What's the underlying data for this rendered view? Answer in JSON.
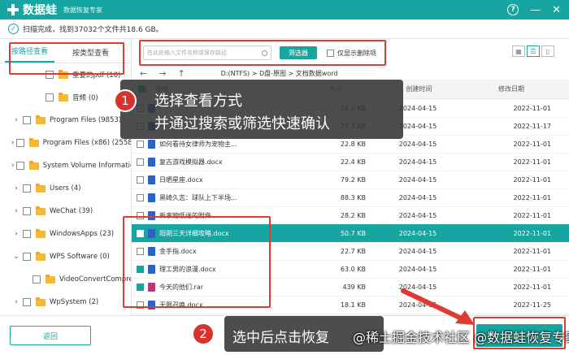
{
  "app": {
    "name": "数据蛙",
    "subtitle": "数据恢复专家",
    "help": "?",
    "minimize": "—",
    "close": "✕"
  },
  "status": {
    "text": "扫描完成，找到37032个文件共18.6 GB。"
  },
  "sidebar": {
    "tabs": [
      {
        "label": "按路径查看"
      },
      {
        "label": "按类型查看"
      }
    ],
    "items": [
      {
        "label": "重要的pdf (18)",
        "arrow": ""
      },
      {
        "label": "音频 (0)",
        "arrow": ""
      },
      {
        "label": "Program Files (9853)",
        "arrow": "›"
      },
      {
        "label": "Program Files (x86) (2558)",
        "arrow": "›"
      },
      {
        "label": "System Volume Informatic",
        "arrow": "›"
      },
      {
        "label": "Users (4)",
        "arrow": "›"
      },
      {
        "label": "WeChat (39)",
        "arrow": "›"
      },
      {
        "label": "WindowsApps (23)",
        "arrow": "›"
      },
      {
        "label": "WPS Software (0)",
        "arrow": "⌄"
      },
      {
        "label": "VideoConvertCompres",
        "arrow": ""
      },
      {
        "label": "WpSystem (2)",
        "arrow": "›"
      },
      {
        "label": "...",
        "arrow": ""
      }
    ]
  },
  "search": {
    "placeholder": "在此处输入文件名称或保存路径",
    "filter_label": "筛选器",
    "only_deleted": "仅显示删除项"
  },
  "path": {
    "back": "←",
    "forward": "→",
    "up": "↑",
    "text": "D:(NTFS) > D盘-原图 > 文档数据word"
  },
  "table": {
    "headers": {
      "name": "名称",
      "size": "大小",
      "ctime": "创建时间",
      "mtime": "修改日期"
    },
    "rows": [
      {
        "name": "",
        "size": "26.0 KB",
        "ctime": "2024-04-15",
        "mtime": "2022-11-01",
        "checked": false,
        "type": "doc"
      },
      {
        "name": "",
        "size": "23.7 KB",
        "ctime": "2024-04-15",
        "mtime": "2022-11-17",
        "checked": false,
        "type": "doc"
      },
      {
        "name": "如何看待女律师为宠物主...",
        "size": "22.8 KB",
        "ctime": "2024-04-15",
        "mtime": "2022-11-01",
        "checked": false,
        "type": "doc"
      },
      {
        "name": "复古游戏模拟器.docx",
        "size": "22.4 KB",
        "ctime": "2024-04-15",
        "mtime": "2022-11-01",
        "checked": false,
        "type": "doc"
      },
      {
        "name": "日晒星座.docx",
        "size": "79.2 KB",
        "ctime": "2024-04-15",
        "mtime": "2022-11-01",
        "checked": false,
        "type": "doc"
      },
      {
        "name": "黑崎久志：球队上下半场...",
        "size": "88.3 KB",
        "ctime": "2024-04-15",
        "mtime": "2022-11-01",
        "checked": false,
        "type": "doc"
      },
      {
        "name": "新事物低迷的附件...",
        "size": "28.2 KB",
        "ctime": "2024-04-15",
        "mtime": "2022-11-01",
        "checked": false,
        "type": "doc"
      },
      {
        "name": "阳朔三天详细攻略.docx",
        "size": "50.7 KB",
        "ctime": "2024-04-15",
        "mtime": "2022-11-01",
        "checked": true,
        "type": "doc"
      },
      {
        "name": "金手指.docx",
        "size": "22.7 KB",
        "ctime": "2024-04-15",
        "mtime": "2022-11-01",
        "checked": false,
        "type": "doc"
      },
      {
        "name": "理工男的浪漫.docx",
        "size": "63.0 KB",
        "ctime": "2024-04-15",
        "mtime": "2022-11-01",
        "checked": true,
        "type": "doc"
      },
      {
        "name": "今天的他们.rar",
        "size": "439 KB",
        "ctime": "2024-04-15",
        "mtime": "2022-11-01",
        "checked": true,
        "type": "rar"
      },
      {
        "name": "无限召唤.docx",
        "size": "18.1 KB",
        "ctime": "2024-04-15",
        "mtime": "2022-11-25",
        "checked": false,
        "type": "doc"
      }
    ]
  },
  "footer": {
    "back_label": "返回",
    "recover_label": "恢复"
  },
  "annotations": {
    "step1_num": "1",
    "step1_line1": "选择查看方式",
    "step1_line2": "并通过搜索或筛选快速确认",
    "step2_num": "2",
    "step2_text": "选中后点击恢复",
    "watermark": "@稀土掘金技术社区 @数据蛙恢复专家"
  },
  "colors": {
    "accent": "#16a5a0",
    "highlight": "#e03b33"
  }
}
